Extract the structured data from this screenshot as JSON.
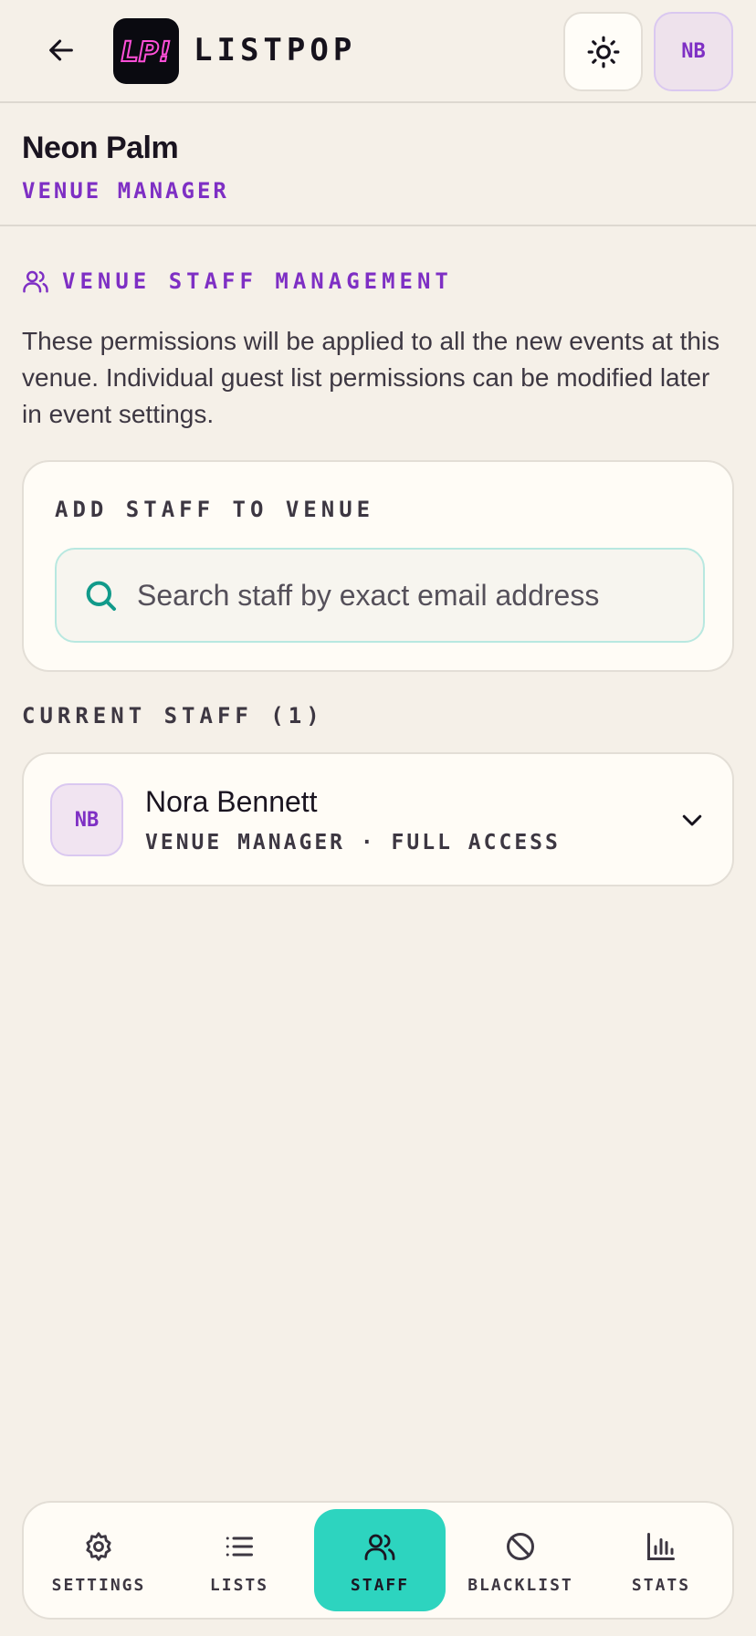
{
  "header": {
    "back_icon": "arrow-left-icon",
    "logo_text": "LP!",
    "brand": "LISTPOP",
    "theme_icon": "sun-icon",
    "avatar_initials": "NB"
  },
  "venue": {
    "name": "Neon Palm",
    "role": "VENUE MANAGER"
  },
  "staff_section": {
    "icon": "users-icon",
    "title": "VENUE STAFF MANAGEMENT",
    "description": "These permissions will be applied to all the new events at this venue. Individual guest list permissions can be modified later in event settings."
  },
  "add_staff": {
    "title": "ADD STAFF TO VENUE",
    "search_icon": "search-icon",
    "search_placeholder": "Search staff by exact email address",
    "search_value": ""
  },
  "current_staff": {
    "title": "CURRENT STAFF (1)",
    "members": [
      {
        "initials": "NB",
        "name": "Nora Bennett",
        "role": "VENUE MANAGER · FULL ACCESS",
        "expand_icon": "chevron-down-icon"
      }
    ]
  },
  "bottom_nav": {
    "items": [
      {
        "label": "SETTINGS",
        "icon": "gear-icon",
        "active": false
      },
      {
        "label": "LISTS",
        "icon": "list-icon",
        "active": false
      },
      {
        "label": "STAFF",
        "icon": "users-icon",
        "active": true
      },
      {
        "label": "BLACKLIST",
        "icon": "ban-icon",
        "active": false
      },
      {
        "label": "STATS",
        "icon": "bar-chart-icon",
        "active": false
      }
    ]
  },
  "colors": {
    "background": "#f5f0e8",
    "accent_purple": "#7e2fc4",
    "accent_teal": "#2dd4bf",
    "card": "#fffcf6"
  }
}
